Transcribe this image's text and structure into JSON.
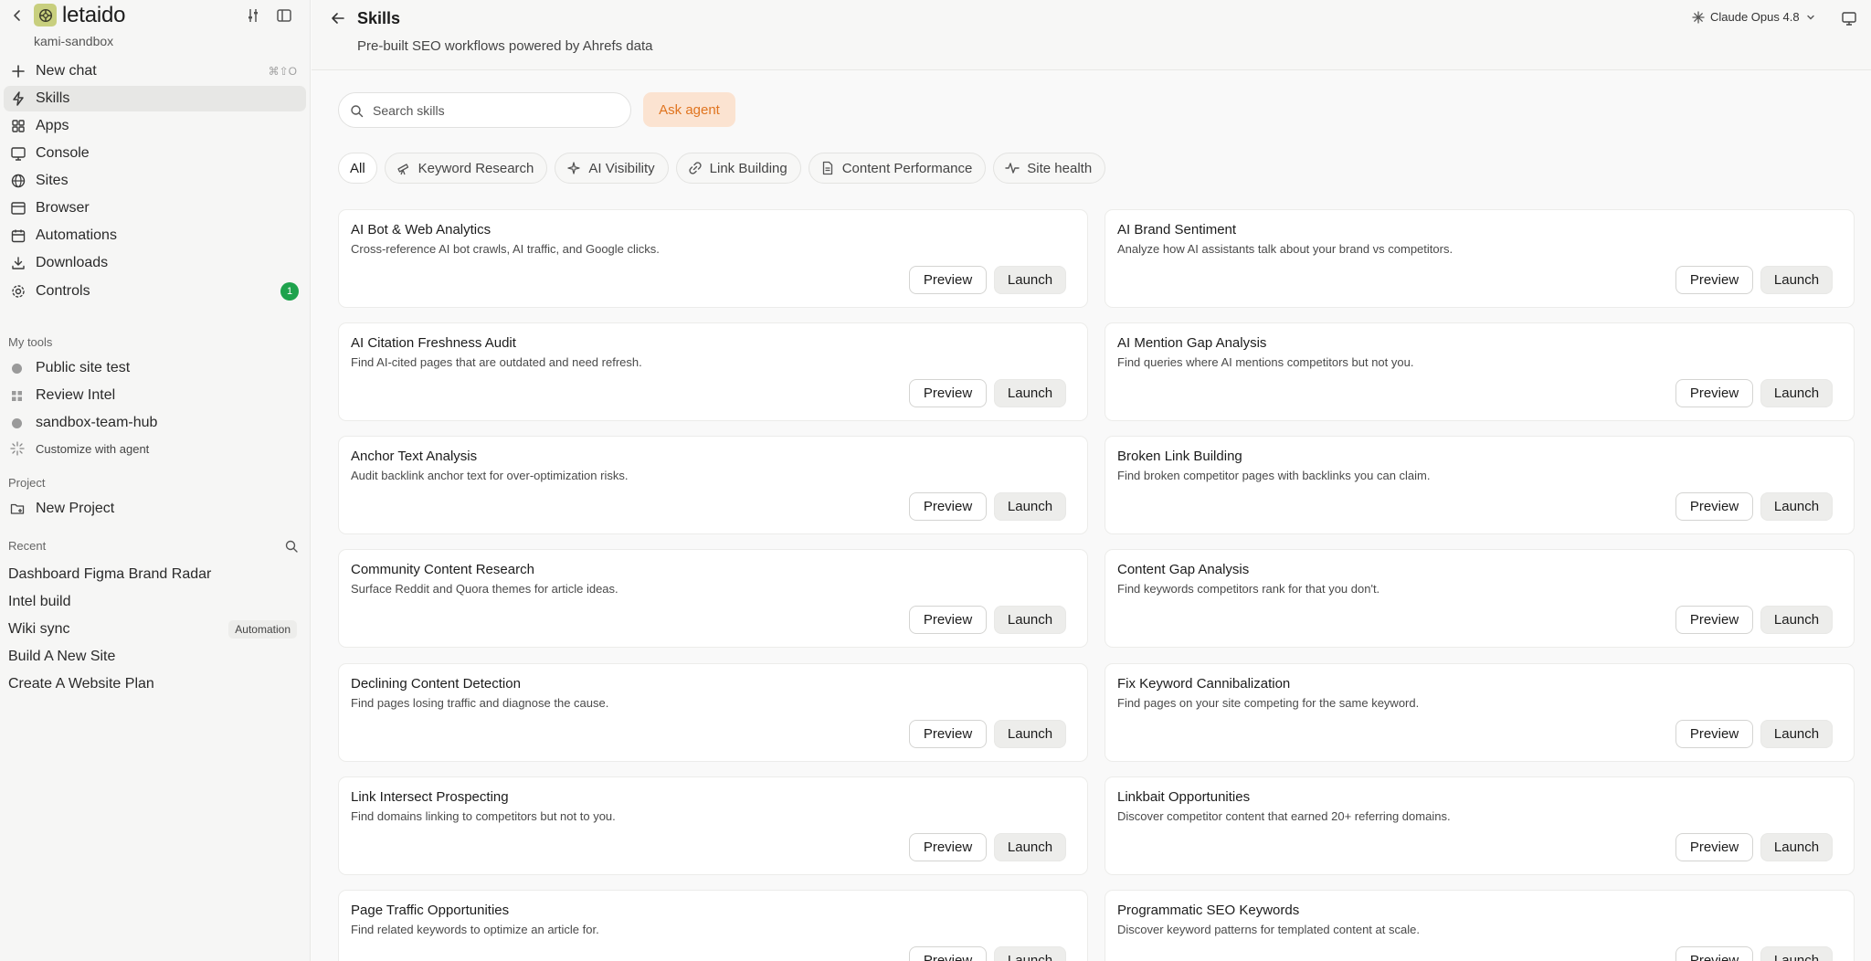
{
  "app": {
    "brand": "letaido",
    "workspace": "kami-sandbox"
  },
  "sidebar": {
    "nav": [
      {
        "label": "New chat",
        "icon": "plus-icon",
        "shortcut": "⌘⇧O"
      },
      {
        "label": "Skills",
        "icon": "bolt-icon",
        "active": true
      },
      {
        "label": "Apps",
        "icon": "apps-grid-icon"
      },
      {
        "label": "Console",
        "icon": "monitor-icon"
      },
      {
        "label": "Sites",
        "icon": "globe-icon"
      },
      {
        "label": "Browser",
        "icon": "browser-window-icon"
      },
      {
        "label": "Automations",
        "icon": "calendar-icon"
      },
      {
        "label": "Downloads",
        "icon": "download-icon"
      },
      {
        "label": "Controls",
        "icon": "settings-icon",
        "badge": "1"
      }
    ],
    "my_tools_label": "My tools",
    "tools": [
      {
        "label": "Public site test",
        "icon": "dot-icon"
      },
      {
        "label": "Review Intel",
        "icon": "grid-icon"
      },
      {
        "label": "sandbox-team-hub",
        "icon": "dot-icon"
      },
      {
        "label": "Customize with agent",
        "icon": "sparkle-icon"
      }
    ],
    "project_label": "Project",
    "new_project": "New Project",
    "recent_label": "Recent",
    "recent": [
      {
        "label": "Dashboard Figma Brand Radar"
      },
      {
        "label": "Intel build"
      },
      {
        "label": "Wiki sync",
        "tag": "Automation"
      },
      {
        "label": "Build A New Site"
      },
      {
        "label": "Create A Website Plan"
      }
    ]
  },
  "header": {
    "title": "Skills",
    "subtitle": "Pre-built SEO workflows powered by Ahrefs data",
    "model": "Claude Opus 4.8"
  },
  "search": {
    "placeholder": "Search skills",
    "value": ""
  },
  "ask_agent": "Ask agent",
  "filters": [
    {
      "label": "All",
      "active": true
    },
    {
      "label": "Keyword Research",
      "icon": "telescope-icon"
    },
    {
      "label": "AI Visibility",
      "icon": "ai-sparkle-icon"
    },
    {
      "label": "Link Building",
      "icon": "link-icon"
    },
    {
      "label": "Content Performance",
      "icon": "document-icon"
    },
    {
      "label": "Site health",
      "icon": "pulse-icon"
    }
  ],
  "buttons": {
    "preview": "Preview",
    "launch": "Launch"
  },
  "skills": [
    {
      "title": "AI Bot & Web Analytics",
      "desc": "Cross-reference AI bot crawls, AI traffic, and Google clicks."
    },
    {
      "title": "AI Brand Sentiment",
      "desc": "Analyze how AI assistants talk about your brand vs competitors."
    },
    {
      "title": "AI Citation Freshness Audit",
      "desc": "Find AI-cited pages that are outdated and need refresh."
    },
    {
      "title": "AI Mention Gap Analysis",
      "desc": "Find queries where AI mentions competitors but not you."
    },
    {
      "title": "Anchor Text Analysis",
      "desc": "Audit backlink anchor text for over-optimization risks."
    },
    {
      "title": "Broken Link Building",
      "desc": "Find broken competitor pages with backlinks you can claim."
    },
    {
      "title": "Community Content Research",
      "desc": "Surface Reddit and Quora themes for article ideas."
    },
    {
      "title": "Content Gap Analysis",
      "desc": "Find keywords competitors rank for that you don't."
    },
    {
      "title": "Declining Content Detection",
      "desc": "Find pages losing traffic and diagnose the cause."
    },
    {
      "title": "Fix Keyword Cannibalization",
      "desc": "Find pages on your site competing for the same keyword."
    },
    {
      "title": "Link Intersect Prospecting",
      "desc": "Find domains linking to competitors but not to you."
    },
    {
      "title": "Linkbait Opportunities",
      "desc": "Discover competitor content that earned 20+ referring domains."
    },
    {
      "title": "Page Traffic Opportunities",
      "desc": "Find related keywords to optimize an article for."
    },
    {
      "title": "Programmatic SEO Keywords",
      "desc": "Discover keyword patterns for templated content at scale."
    }
  ]
}
